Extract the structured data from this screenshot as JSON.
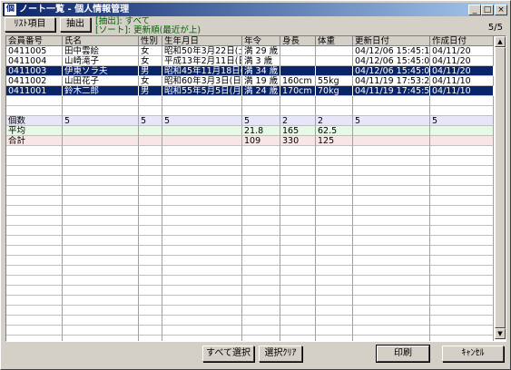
{
  "window": {
    "icon_text": "個",
    "title": "ノート一覧 - 個人情報管理",
    "buttons": [
      "_",
      "□",
      "×"
    ]
  },
  "toolbar": {
    "list_items_label": "ﾘｽﾄ項目",
    "extract_label": "抽出",
    "filter_line": "[抽出]: すべて",
    "sort_line": "[ソート]: 更新順(最近が上)",
    "count": "5/5"
  },
  "columns": [
    "会員番号",
    "氏名",
    "性別",
    "生年月日",
    "年令",
    "身長",
    "体重",
    "更新日付",
    "作成日付"
  ],
  "rows": [
    [
      "0411005",
      "田中雲絵",
      "女",
      "昭和50年3月22日(土",
      "満 29 歳",
      "",
      "",
      "04/12/06 15:45:19",
      "04/11/20"
    ],
    [
      "0411004",
      "山崎滝子",
      "女",
      "平成13年2月11日(日",
      "満 3 歳",
      "",
      "",
      "04/12/06 15:45:08",
      "04/11/20"
    ],
    [
      "0411003",
      "伊東ソラ夫",
      "男",
      "昭和45年11月18日(水",
      "満 34 歳",
      "",
      "",
      "04/12/06 15:45:02",
      "04/11/20"
    ],
    [
      "0411002",
      "山田花子",
      "女",
      "昭和60年3月3日(日)",
      "満 19 歳",
      "160cm",
      "55kg",
      "04/11/19 17:53:22",
      "04/11/10"
    ],
    [
      "0411001",
      "鈴木二郎",
      "男",
      "昭和55年5月5日(月)",
      "満 24 歳",
      "170cm",
      "70kg",
      "04/11/19 17:45:53",
      "04/11/10"
    ]
  ],
  "selected_rows": [
    2,
    4
  ],
  "summary": [
    {
      "label": "個数",
      "values": [
        "5",
        "5",
        "5",
        "5",
        "2",
        "2",
        "5",
        "5"
      ]
    },
    {
      "label": "平均",
      "values": [
        "",
        "",
        "",
        "21.8",
        "165",
        "62.5",
        "",
        ""
      ]
    },
    {
      "label": "合計",
      "values": [
        "",
        "",
        "",
        "109",
        "330",
        "125",
        "",
        ""
      ]
    }
  ],
  "footer": {
    "select_all": "すべて選択",
    "clear_selection": "選択ｸﾘｱ",
    "print": "印刷",
    "cancel": "ｷｬﾝｾﾙ"
  },
  "colors": {
    "selected_bg": "#0a246a",
    "count_row_bg": "#e6e6f8",
    "avg_row_bg": "#e6f8e6",
    "sum_row_bg": "#f8e6e6",
    "filter_text": "#006000"
  }
}
